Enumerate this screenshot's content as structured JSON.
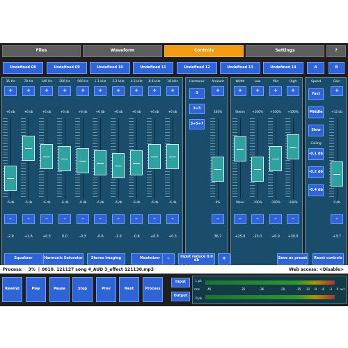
{
  "tabs": [
    {
      "label": "Files"
    },
    {
      "label": "Waveform"
    },
    {
      "label": "Controls",
      "active": true
    },
    {
      "label": "Settings"
    },
    {
      "label": "?"
    }
  ],
  "presets": [
    {
      "label": "Undefined 08"
    },
    {
      "label": "Undefined 09"
    },
    {
      "label": "Undefined 10"
    },
    {
      "label": "Undefined 11"
    },
    {
      "label": "Undefined 12"
    },
    {
      "label": "Undefined 13"
    },
    {
      "label": "Undefined 14"
    },
    {
      "label": "A"
    },
    {
      "label": "B"
    }
  ],
  "eq": {
    "bands": [
      {
        "freq": "35 Hz",
        "max": "+6 db",
        "min": "-6 db",
        "value": "-2.9",
        "level": -2.9
      },
      {
        "freq": "70 Hz",
        "max": "+6 db",
        "min": "-6 db",
        "value": "+1.6",
        "level": 1.6
      },
      {
        "freq": "140 Hz",
        "max": "+6 db",
        "min": "-6 db",
        "value": "+0.3",
        "level": 0.3
      },
      {
        "freq": "280 Hz",
        "max": "+6 db",
        "min": "-6 db",
        "value": "0.0",
        "level": 0.0
      },
      {
        "freq": "560 Hz",
        "max": "+6 db",
        "min": "-6 db",
        "value": "-0.3",
        "level": -0.3
      },
      {
        "freq": "1.1 kHz",
        "max": "+6 db",
        "min": "-6 db",
        "value": "-0.6",
        "level": -0.6
      },
      {
        "freq": "2.2 kHz",
        "max": "+6 db",
        "min": "-6 db",
        "value": "-1.0",
        "level": -1.0
      },
      {
        "freq": "4.3 kHz",
        "max": "+6 db",
        "min": "-6 db",
        "value": "-0.6",
        "level": -0.6
      },
      {
        "freq": "8.6 kHz",
        "max": "+6 db",
        "min": "-6 db",
        "value": "+0.3",
        "level": 0.3
      },
      {
        "freq": "18 kHz",
        "max": "+6 db",
        "min": "-6 db",
        "value": "+0.3",
        "level": 0.3
      }
    ]
  },
  "harmonic": {
    "label": "Harmonic",
    "options": [
      "3",
      "3+5",
      "3+5+7"
    ],
    "selected": "3"
  },
  "amount": {
    "label": "Amount",
    "max": "100%",
    "min": "0%",
    "value": "36.7",
    "level": 0.367
  },
  "stereo": {
    "columns": [
      {
        "label": "Width",
        "max": "Stereo",
        "min": "Mono",
        "value": "+25.0",
        "level": 0.625
      },
      {
        "label": "Low",
        "max": "+100%",
        "min": "-100%",
        "value": "-25.0",
        "level": 0.375
      },
      {
        "label": "Mid",
        "max": "+100%",
        "min": "-100%",
        "value": "+0.0",
        "level": 0.5
      },
      {
        "label": "High",
        "max": "+100%",
        "min": "-100%",
        "value": "+30.0",
        "level": 0.65
      }
    ]
  },
  "speed": {
    "label": "Speed",
    "options": [
      "Fast",
      "Middle",
      "Slow"
    ],
    "selected": "Middle",
    "ceiling_label": "Ceiling",
    "ceiling_options": [
      "-0.1 db",
      "-0.2 db",
      "-0.4 db"
    ]
  },
  "gain": {
    "label": "Gain",
    "max": "+12 db",
    "min": "0 db",
    "value": "+3.7",
    "level": 0.308
  },
  "buttons": {
    "plus": "+",
    "minus": "–"
  },
  "modules": [
    "Equalizer",
    "Harmonic Saturator",
    "Stereo Imaging",
    "Maximizer"
  ],
  "input_reduce": {
    "minus": "–",
    "label": "Input reduce 0.0 db",
    "plus": "+"
  },
  "save_preset": "Save as preset",
  "reset_controls": "Reset controls",
  "status": {
    "process_label": "Process:",
    "percent": "3%",
    "track": "0010. 121127 song 4_AUD 3_effect 121130.mp3",
    "web_access": "Web access: <Disable>"
  },
  "transport": [
    "Rewind",
    "Play",
    "Pause",
    "Stop",
    "Prev",
    "Next",
    "Process"
  ],
  "io": {
    "input": "Input",
    "output": "Output"
  },
  "meter": {
    "l": "L pk",
    "r": "R pk",
    "rms": "rms",
    "scale": [
      "-45",
      "-35",
      "-26",
      "-20",
      "-15",
      "-12",
      "-9",
      "-6",
      "-3",
      "0",
      "ovr"
    ]
  }
}
